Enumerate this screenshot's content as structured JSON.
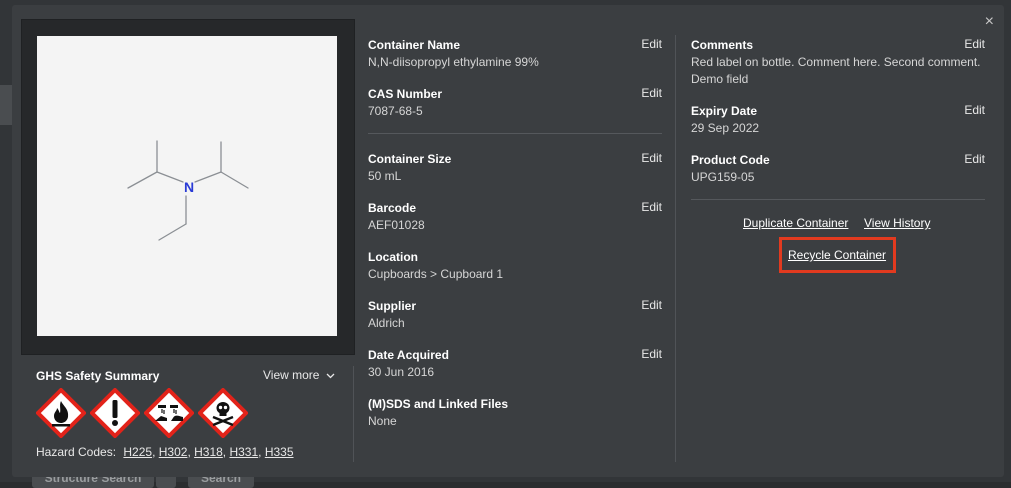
{
  "modal": {
    "close_label": "×",
    "ghs": {
      "title": "GHS Safety Summary",
      "view_more": "View more",
      "pictograms": [
        "flame-pictogram",
        "exclamation-pictogram",
        "corrosion-pictogram",
        "skull-crossbones-pictogram"
      ],
      "hazard_label": "Hazard Codes:",
      "hazard_codes": [
        "H225",
        "H302",
        "H318",
        "H331",
        "H335"
      ]
    },
    "structure": {
      "atom_label": "N"
    },
    "fields_col1": [
      {
        "label": "Container Name",
        "value": "N,N-diisopropyl ethylamine 99%",
        "edit": "Edit"
      },
      {
        "label": "CAS Number",
        "value": "7087-68-5",
        "edit": "Edit"
      },
      {
        "label": "Container Size",
        "value": "50 mL",
        "edit": "Edit"
      },
      {
        "label": "Barcode",
        "value": "AEF01028",
        "edit": "Edit"
      },
      {
        "label": "Location",
        "value": "Cupboards > Cupboard 1"
      },
      {
        "label": "Supplier",
        "value": "Aldrich",
        "edit": "Edit"
      },
      {
        "label": "Date Acquired",
        "value": "30 Jun 2016",
        "edit": "Edit"
      },
      {
        "label": "(M)SDS and Linked Files",
        "value": "None"
      }
    ],
    "fields_col2": [
      {
        "label": "Comments",
        "value": "Red label on bottle. Comment here. Second comment. Demo field",
        "edit": "Edit"
      },
      {
        "label": "Expiry Date",
        "value": "29 Sep 2022",
        "edit": "Edit"
      },
      {
        "label": "Product Code",
        "value": "UPG159-05",
        "edit": "Edit"
      }
    ],
    "actions": {
      "duplicate": "Duplicate Container",
      "history": "View History",
      "recycle": "Recycle Container"
    }
  },
  "background": {
    "structure_search": "Structure Search",
    "search": "Search"
  },
  "colors": {
    "highlight": "#e23a1f",
    "nitrogen": "#2a3bd6",
    "ghs_red": "#e2231a"
  }
}
